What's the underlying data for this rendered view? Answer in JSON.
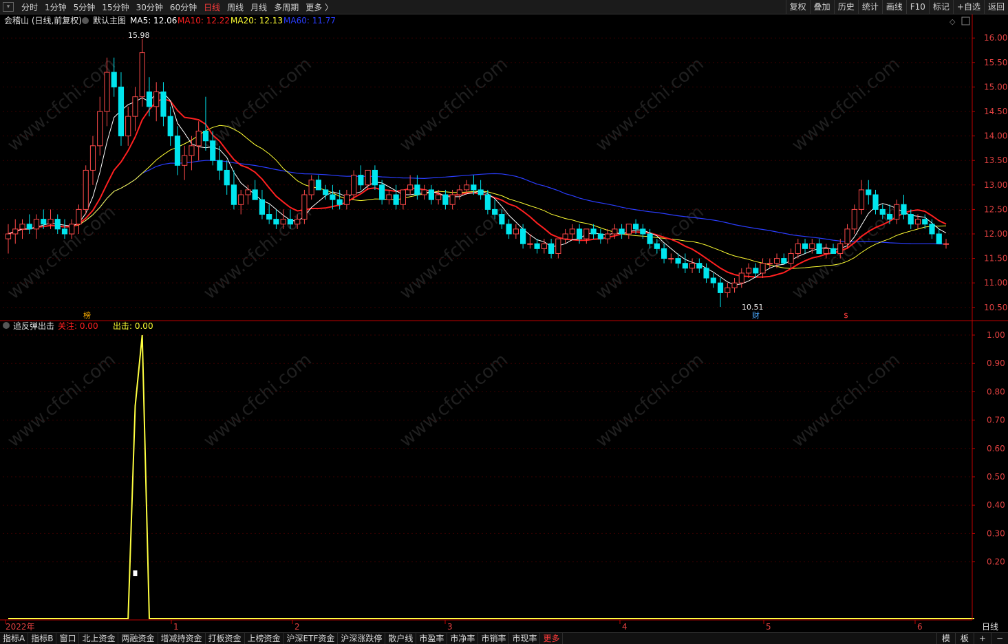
{
  "toolbar": {
    "periods": [
      "分时",
      "1分钟",
      "5分钟",
      "15分钟",
      "30分钟",
      "60分钟",
      "日线",
      "周线",
      "月线",
      "多周期",
      "更多 〉"
    ],
    "active_index": 6,
    "right_buttons": [
      "复权",
      "叠加",
      "历史",
      "统计",
      "画线",
      "F10",
      "标记",
      "+自选",
      "返回"
    ]
  },
  "main_chart": {
    "stock": "会稽山 (日线,前复权)",
    "template": "默认主图",
    "ma5": "MA5: 12.06",
    "ma10": "MA10: 12.22",
    "ma20": "MA20: 12.13",
    "ma60": "MA60: 11.77",
    "high_label": "15.98",
    "low_label": "10.51",
    "marks": [
      "榜",
      "财",
      "$"
    ],
    "price_ticks": [
      "16.00",
      "15.50",
      "15.00",
      "14.50",
      "14.00",
      "13.50",
      "13.00",
      "12.50",
      "12.00",
      "11.50",
      "11.00",
      "10.50"
    ]
  },
  "indicator": {
    "name": "追反弹出击",
    "guanzhu": "关注: 0.00",
    "chuji": "出击: 0.00",
    "ticks": [
      "1.00",
      "0.90",
      "0.80",
      "0.70",
      "0.60",
      "0.50",
      "0.40",
      "0.30",
      "0.20"
    ]
  },
  "time_axis": {
    "labels": [
      "2022年",
      "1",
      "2",
      "3",
      "4",
      "5",
      "6"
    ],
    "period_label": "日线"
  },
  "bottom_tabs": [
    "指标A",
    "指标B",
    "窗口",
    "北上资金",
    "两融资金",
    "增减持资金",
    "打板资金",
    "上榜资金",
    "沪深ETF资金",
    "沪深涨跌停",
    "散户线",
    "市盈率",
    "市净率",
    "市销率",
    "市现率",
    "更多"
  ],
  "bottom_right": [
    "模",
    "板",
    "+",
    "−"
  ],
  "watermark": "www.cfchi.com",
  "colors": {
    "up": "#ff4a4a",
    "down": "#00e5ee",
    "ma5": "#ffffff",
    "ma10": "#ff2020",
    "ma20": "#ffff33",
    "ma60": "#2a3dff",
    "indicator_line": "#ffff40",
    "axis": "#c00000"
  },
  "chart_data": {
    "type": "candlestick",
    "ohlc": [
      [
        11.9,
        12.2,
        11.6,
        12.0
      ],
      [
        12.0,
        12.3,
        11.8,
        12.1
      ],
      [
        12.1,
        12.3,
        11.9,
        12.2
      ],
      [
        12.2,
        12.4,
        12.0,
        12.1
      ],
      [
        12.1,
        12.4,
        11.9,
        12.3
      ],
      [
        12.3,
        12.5,
        12.1,
        12.2
      ],
      [
        12.2,
        12.5,
        12.1,
        12.3
      ],
      [
        12.3,
        12.4,
        12.0,
        12.1
      ],
      [
        12.1,
        12.3,
        11.9,
        12.0
      ],
      [
        12.0,
        12.3,
        11.9,
        12.2
      ],
      [
        12.2,
        12.6,
        12.0,
        12.5
      ],
      [
        12.5,
        13.4,
        12.4,
        13.3
      ],
      [
        13.3,
        14.0,
        13.0,
        13.8
      ],
      [
        13.8,
        14.8,
        13.6,
        14.5
      ],
      [
        14.5,
        15.6,
        14.2,
        15.3
      ],
      [
        15.3,
        15.6,
        14.8,
        15.0
      ],
      [
        15.0,
        15.3,
        13.8,
        14.0
      ],
      [
        14.0,
        14.6,
        13.8,
        14.4
      ],
      [
        14.4,
        15.0,
        14.1,
        14.8
      ],
      [
        14.8,
        15.98,
        14.6,
        15.7
      ],
      [
        14.9,
        15.2,
        14.4,
        14.6
      ],
      [
        14.6,
        15.1,
        14.3,
        14.9
      ],
      [
        14.9,
        15.1,
        14.2,
        14.4
      ],
      [
        14.4,
        14.6,
        13.8,
        14.0
      ],
      [
        14.0,
        14.2,
        13.2,
        13.4
      ],
      [
        13.4,
        13.8,
        13.1,
        13.6
      ],
      [
        13.6,
        14.0,
        13.3,
        13.8
      ],
      [
        13.8,
        14.3,
        13.5,
        14.1
      ],
      [
        14.1,
        14.8,
        13.7,
        13.9
      ],
      [
        13.9,
        14.1,
        13.4,
        13.5
      ],
      [
        13.5,
        13.8,
        13.1,
        13.3
      ],
      [
        13.3,
        13.5,
        12.8,
        13.0
      ],
      [
        13.0,
        13.3,
        12.5,
        12.6
      ],
      [
        12.6,
        12.9,
        12.4,
        12.8
      ],
      [
        12.8,
        13.0,
        12.6,
        12.9
      ],
      [
        12.9,
        13.1,
        12.7,
        12.7
      ],
      [
        12.7,
        12.9,
        12.3,
        12.4
      ],
      [
        12.4,
        12.6,
        12.2,
        12.3
      ],
      [
        12.3,
        12.5,
        12.1,
        12.2
      ],
      [
        12.2,
        12.5,
        12.1,
        12.3
      ],
      [
        12.3,
        12.5,
        12.1,
        12.2
      ],
      [
        12.2,
        12.4,
        12.1,
        12.3
      ],
      [
        12.3,
        12.9,
        12.2,
        12.8
      ],
      [
        12.8,
        13.2,
        12.7,
        13.1
      ],
      [
        13.1,
        13.2,
        12.9,
        12.9
      ],
      [
        12.9,
        13.0,
        12.7,
        12.8
      ],
      [
        12.8,
        13.0,
        12.5,
        12.7
      ],
      [
        12.7,
        12.9,
        12.5,
        12.6
      ],
      [
        12.6,
        12.9,
        12.5,
        12.8
      ],
      [
        12.8,
        13.3,
        12.7,
        13.2
      ],
      [
        13.2,
        13.4,
        12.9,
        13.0
      ],
      [
        13.0,
        13.3,
        12.9,
        13.3
      ],
      [
        13.3,
        13.4,
        12.9,
        13.0
      ],
      [
        13.0,
        13.1,
        12.6,
        12.7
      ],
      [
        12.7,
        12.9,
        12.6,
        12.8
      ],
      [
        12.8,
        13.0,
        12.5,
        12.6
      ],
      [
        12.6,
        12.9,
        12.5,
        12.9
      ],
      [
        12.9,
        13.2,
        12.8,
        13.0
      ],
      [
        13.0,
        13.2,
        12.7,
        12.8
      ],
      [
        12.8,
        13.0,
        12.7,
        12.9
      ],
      [
        12.9,
        13.0,
        12.6,
        12.7
      ],
      [
        12.7,
        12.9,
        12.6,
        12.8
      ],
      [
        12.8,
        12.9,
        12.5,
        12.6
      ],
      [
        12.6,
        12.9,
        12.5,
        12.8
      ],
      [
        12.8,
        13.0,
        12.7,
        12.9
      ],
      [
        12.9,
        13.1,
        12.8,
        13.0
      ],
      [
        13.0,
        13.2,
        12.8,
        12.9
      ],
      [
        12.9,
        13.1,
        12.7,
        12.8
      ],
      [
        12.8,
        12.9,
        12.4,
        12.5
      ],
      [
        12.5,
        12.7,
        12.3,
        12.4
      ],
      [
        12.4,
        12.5,
        12.1,
        12.2
      ],
      [
        12.2,
        12.3,
        11.9,
        12.0
      ],
      [
        12.0,
        12.2,
        11.9,
        12.1
      ],
      [
        12.1,
        12.2,
        11.7,
        11.8
      ],
      [
        11.8,
        12.0,
        11.7,
        11.8
      ],
      [
        11.8,
        11.9,
        11.6,
        11.7
      ],
      [
        11.7,
        11.9,
        11.6,
        11.8
      ],
      [
        11.8,
        11.9,
        11.5,
        11.6
      ],
      [
        11.6,
        11.9,
        11.5,
        11.9
      ],
      [
        11.9,
        12.1,
        11.8,
        12.0
      ],
      [
        12.0,
        12.2,
        11.9,
        12.1
      ],
      [
        12.1,
        12.2,
        11.8,
        11.9
      ],
      [
        11.9,
        12.1,
        11.8,
        12.1
      ],
      [
        12.1,
        12.2,
        11.9,
        12.0
      ],
      [
        12.0,
        12.1,
        11.8,
        11.9
      ],
      [
        11.9,
        12.1,
        11.8,
        12.0
      ],
      [
        12.0,
        12.2,
        11.9,
        12.1
      ],
      [
        12.1,
        12.2,
        11.9,
        12.0
      ],
      [
        12.0,
        12.2,
        11.9,
        12.2
      ],
      [
        12.2,
        12.3,
        12.0,
        12.1
      ],
      [
        12.1,
        12.2,
        11.9,
        12.0
      ],
      [
        12.0,
        12.1,
        11.7,
        11.8
      ],
      [
        11.8,
        11.9,
        11.6,
        11.7
      ],
      [
        11.7,
        11.8,
        11.4,
        11.5
      ],
      [
        11.5,
        11.6,
        11.4,
        11.5
      ],
      [
        11.5,
        11.6,
        11.3,
        11.4
      ],
      [
        11.4,
        11.6,
        11.2,
        11.3
      ],
      [
        11.3,
        11.5,
        11.2,
        11.4
      ],
      [
        11.4,
        11.5,
        11.2,
        11.3
      ],
      [
        11.3,
        11.4,
        11.0,
        11.1
      ],
      [
        11.1,
        11.2,
        10.9,
        11.0
      ],
      [
        11.0,
        11.1,
        10.51,
        10.8
      ],
      [
        10.8,
        11.0,
        10.7,
        10.9
      ],
      [
        10.9,
        11.1,
        10.8,
        11.0
      ],
      [
        11.0,
        11.3,
        10.9,
        11.2
      ],
      [
        11.2,
        11.4,
        11.1,
        11.3
      ],
      [
        11.3,
        11.4,
        11.1,
        11.2
      ],
      [
        11.2,
        11.5,
        11.1,
        11.4
      ],
      [
        11.4,
        11.5,
        11.3,
        11.4
      ],
      [
        11.4,
        11.6,
        11.3,
        11.5
      ],
      [
        11.5,
        11.6,
        11.4,
        11.4
      ],
      [
        11.4,
        11.7,
        11.3,
        11.6
      ],
      [
        11.6,
        11.9,
        11.5,
        11.8
      ],
      [
        11.8,
        11.9,
        11.6,
        11.7
      ],
      [
        11.7,
        11.9,
        11.6,
        11.8
      ],
      [
        11.8,
        11.9,
        11.6,
        11.6
      ],
      [
        11.6,
        11.8,
        11.5,
        11.7
      ],
      [
        11.7,
        11.8,
        11.6,
        11.6
      ],
      [
        11.6,
        11.9,
        11.5,
        11.8
      ],
      [
        11.8,
        12.2,
        11.7,
        12.1
      ],
      [
        12.1,
        12.6,
        12.0,
        12.5
      ],
      [
        12.5,
        13.1,
        12.4,
        12.9
      ],
      [
        12.9,
        13.1,
        12.6,
        12.8
      ],
      [
        12.8,
        12.9,
        12.4,
        12.5
      ],
      [
        12.5,
        12.6,
        12.3,
        12.4
      ],
      [
        12.4,
        12.6,
        12.2,
        12.3
      ],
      [
        12.3,
        12.7,
        12.2,
        12.6
      ],
      [
        12.6,
        12.8,
        12.3,
        12.4
      ],
      [
        12.4,
        12.5,
        12.1,
        12.2
      ],
      [
        12.2,
        12.4,
        12.1,
        12.3
      ],
      [
        12.3,
        12.4,
        12.1,
        12.2
      ],
      [
        12.2,
        12.3,
        11.9,
        12.0
      ],
      [
        12.0,
        12.1,
        11.8,
        11.8
      ],
      [
        11.8,
        11.9,
        11.7,
        11.8
      ]
    ],
    "ylim": [
      10.3,
      16.2
    ],
    "ma_series": [
      "MA5",
      "MA10",
      "MA20",
      "MA60"
    ],
    "indicator_series": {
      "name": "出击",
      "spike_start_index": 18,
      "values": [
        0,
        0,
        0,
        0,
        0,
        0,
        0,
        0,
        0,
        0,
        0,
        0,
        0,
        0,
        0,
        0,
        0,
        0,
        0.75,
        1.0,
        0,
        0,
        0,
        0,
        0,
        0,
        0,
        0,
        0,
        0,
        0,
        0,
        0,
        0,
        0,
        0,
        0,
        0,
        0,
        0,
        0,
        0,
        0,
        0,
        0,
        0,
        0,
        0,
        0,
        0,
        0,
        0,
        0,
        0,
        0,
        0,
        0,
        0,
        0,
        0,
        0,
        0,
        0,
        0,
        0,
        0,
        0,
        0,
        0,
        0,
        0,
        0,
        0,
        0,
        0,
        0,
        0,
        0,
        0,
        0,
        0,
        0,
        0,
        0,
        0,
        0,
        0,
        0,
        0,
        0,
        0,
        0,
        0,
        0,
        0,
        0,
        0,
        0,
        0,
        0,
        0,
        0,
        0,
        0,
        0,
        0,
        0,
        0,
        0,
        0,
        0,
        0,
        0,
        0,
        0,
        0,
        0,
        0,
        0,
        0,
        0,
        0,
        0,
        0,
        0,
        0,
        0,
        0,
        0,
        0,
        0,
        0,
        0,
        0,
        0,
        0,
        0,
        0
      ],
      "ylim": [
        0,
        1.0
      ]
    }
  }
}
